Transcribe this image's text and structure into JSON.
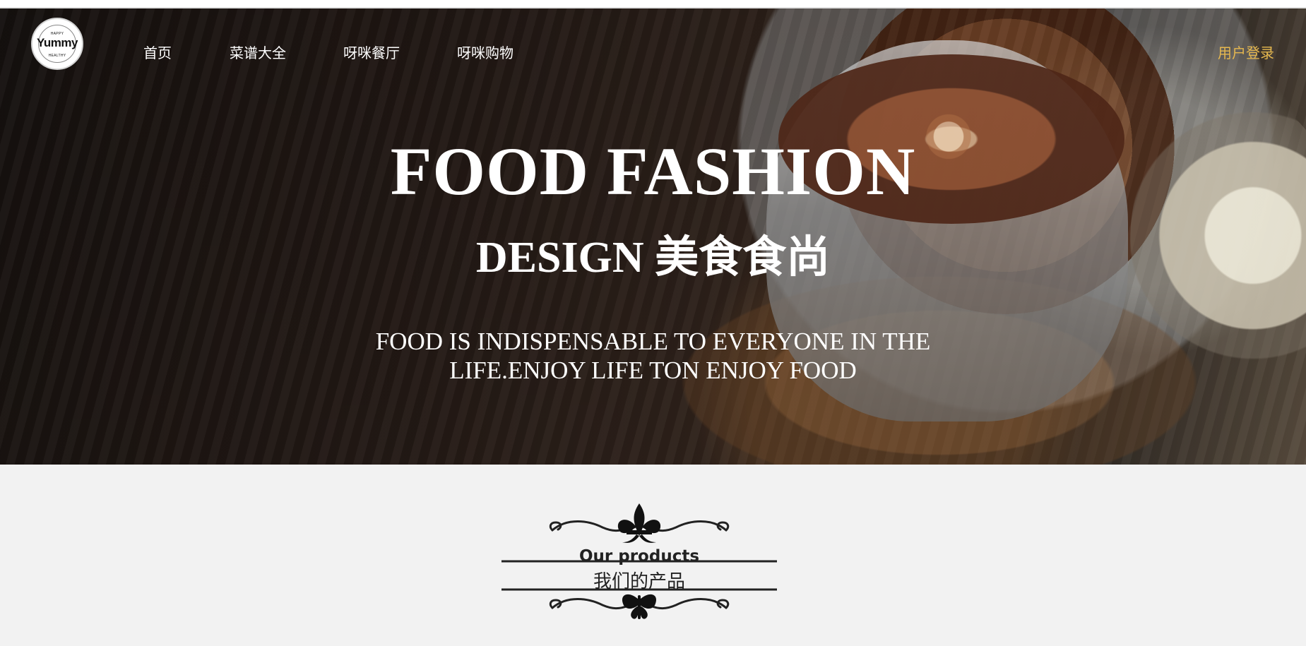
{
  "navbar": {
    "logo": {
      "top_text": "HAPPY",
      "main_text": "Yummy",
      "bottom_text": "HEALTHY"
    },
    "links": [
      {
        "label": "首页"
      },
      {
        "label": "菜谱大全"
      },
      {
        "label": "呀咪餐厅"
      },
      {
        "label": "呀咪购物"
      }
    ],
    "login_label": "用户登录"
  },
  "hero": {
    "title": "FOOD FASHION",
    "subtitle": "DESIGN 美食食尚",
    "tagline_line1": "FOOD IS INDISPENSABLE TO EVERYONE IN THE",
    "tagline_line2": "LIFE.ENJOY LIFE TON ENJOY FOOD"
  },
  "products": {
    "heading_en": "Our products",
    "heading_cn": "我们的产品"
  },
  "colors": {
    "nav_text": "#ffffff",
    "login_text": "#e6b84f",
    "hero_text": "#ffffff",
    "products_background": "#f2f2f2",
    "emblem_color": "#222222"
  },
  "icons": {
    "fleur_de_lis": "fleur-de-lis-icon",
    "butterfly": "butterfly-icon"
  }
}
